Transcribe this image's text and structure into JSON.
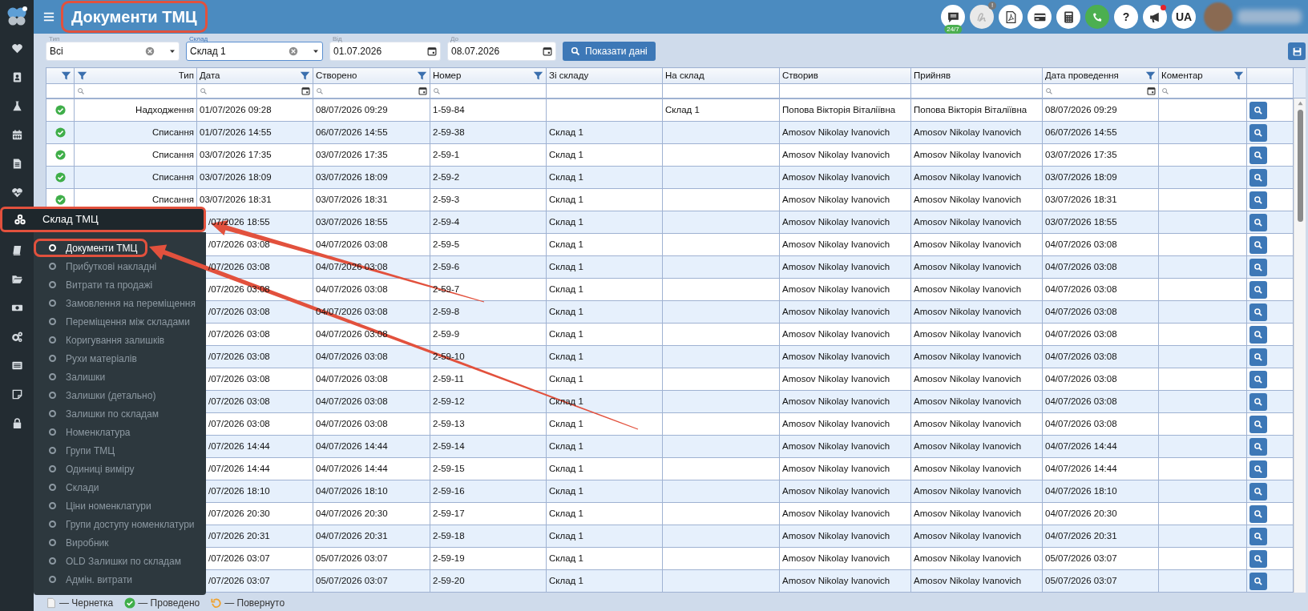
{
  "header": {
    "title": "Документи ТМЦ",
    "highlighted": true,
    "tools": [
      {
        "kind": "chat",
        "badge": "24/7",
        "disabled": false,
        "notification": false
      },
      {
        "kind": "signature",
        "badge": "!",
        "disabled": true,
        "notification": false
      },
      {
        "kind": "pdf",
        "disabled": false,
        "notification": false
      },
      {
        "kind": "card",
        "disabled": false,
        "notification": false
      },
      {
        "kind": "calculator",
        "disabled": false,
        "notification": false
      },
      {
        "kind": "phone",
        "disabled": false,
        "notification": false
      },
      {
        "kind": "help",
        "label": "?",
        "disabled": false,
        "notification": false
      },
      {
        "kind": "announce",
        "disabled": false,
        "notification": true
      },
      {
        "kind": "language",
        "label": "UA",
        "disabled": false,
        "notification": false
      }
    ]
  },
  "sidebar": {
    "items": [
      {
        "kind": "heart",
        "expanded": false
      },
      {
        "kind": "contacts",
        "expanded": false
      },
      {
        "kind": "flask",
        "expanded": false
      },
      {
        "kind": "calendar",
        "expanded": false
      },
      {
        "kind": "document",
        "expanded": false
      },
      {
        "kind": "pulse",
        "expanded": false
      },
      {
        "kind": "boxes",
        "expanded": true,
        "label": "Склад ТМЦ",
        "highlighted": true,
        "children": [
          {
            "label": "Документи ТМЦ",
            "selected": true,
            "highlighted": true
          },
          {
            "label": "Прибуткові накладні",
            "selected": false,
            "highlighted": false
          },
          {
            "label": "Витрати та продажі",
            "selected": false,
            "highlighted": false
          },
          {
            "label": "Замовлення на переміщення",
            "selected": false,
            "highlighted": false
          },
          {
            "label": "Переміщення між складами",
            "selected": false,
            "highlighted": false
          },
          {
            "label": "Коригування залишків",
            "selected": false,
            "highlighted": false
          },
          {
            "label": "Рухи матеріалів",
            "selected": false,
            "highlighted": false
          },
          {
            "label": "Залишки",
            "selected": false,
            "highlighted": false
          },
          {
            "label": "Залишки (детально)",
            "selected": false,
            "highlighted": false
          },
          {
            "label": "Залишки по складам",
            "selected": false,
            "highlighted": false
          },
          {
            "label": "Номенклатура",
            "selected": false,
            "highlighted": false
          },
          {
            "label": "Групи ТМЦ",
            "selected": false,
            "highlighted": false
          },
          {
            "label": "Одиниці виміру",
            "selected": false,
            "highlighted": false
          },
          {
            "label": "Склади",
            "selected": false,
            "highlighted": false
          },
          {
            "label": "Ціни номенклатури",
            "selected": false,
            "highlighted": false
          },
          {
            "label": "Групи доступу номенклатури",
            "selected": false,
            "highlighted": false
          },
          {
            "label": "Виробник",
            "selected": false,
            "highlighted": false
          },
          {
            "label": "OLD Залишки по складам",
            "selected": false,
            "highlighted": false
          },
          {
            "label": "Адмін. витрати",
            "selected": false,
            "highlighted": false
          }
        ]
      },
      {
        "kind": "book",
        "expanded": false
      },
      {
        "kind": "folder",
        "expanded": false
      },
      {
        "kind": "money",
        "expanded": false
      },
      {
        "kind": "gears",
        "expanded": false
      },
      {
        "kind": "list",
        "expanded": false
      },
      {
        "kind": "note",
        "expanded": false
      },
      {
        "kind": "lock",
        "expanded": false
      }
    ]
  },
  "filters": [
    {
      "kind": "select",
      "label": "Тип",
      "value": "Всі",
      "focused": false
    },
    {
      "kind": "select",
      "label": "Склад",
      "value": "Склад 1",
      "focused": true
    },
    {
      "kind": "date",
      "label": "Від",
      "value": "01.07.2026",
      "focused": false
    },
    {
      "kind": "date",
      "label": "До",
      "value": "08.07.2026",
      "focused": false
    }
  ],
  "show_button": "Показати дані",
  "table": {
    "columns": [
      {
        "filter": true,
        "searchable": false,
        "date_search": false
      },
      {
        "label": "Тип",
        "filter": true,
        "searchable": true,
        "date_search": false,
        "right_aligned": true
      },
      {
        "label": "Дата",
        "filter": true,
        "searchable": true,
        "date_search": true,
        "right_aligned": false
      },
      {
        "label": "Створено",
        "filter": true,
        "searchable": true,
        "date_search": true,
        "right_aligned": false
      },
      {
        "label": "Номер",
        "filter": true,
        "searchable": true,
        "date_search": false,
        "right_aligned": false
      },
      {
        "label": "Зі складу",
        "filter": false,
        "searchable": false,
        "date_search": false,
        "right_aligned": false
      },
      {
        "label": "На склад",
        "filter": false,
        "searchable": false,
        "date_search": false,
        "right_aligned": false
      },
      {
        "label": "Створив",
        "filter": false,
        "searchable": false,
        "date_search": false,
        "right_aligned": false
      },
      {
        "label": "Прийняв",
        "filter": false,
        "searchable": false,
        "date_search": false,
        "right_aligned": false
      },
      {
        "label": "Дата проведення",
        "filter": true,
        "searchable": true,
        "date_search": true,
        "right_aligned": false
      },
      {
        "label": "Коментар",
        "filter": true,
        "searchable": true,
        "date_search": false,
        "right_aligned": false
      },
      {
        "filter": false,
        "searchable": false,
        "date_search": false
      }
    ],
    "rows": [
      {
        "posted": true,
        "type": "Надходження",
        "date": "01/07/2026 09:28",
        "created": "08/07/2026 09:29",
        "number": "1-59-84",
        "to": "Склад 1",
        "creator": "Попова Вікторія Віталіївна",
        "acceptor": "Попова Вікторія Віталіївна",
        "posted_at": "08/07/2026 09:29"
      },
      {
        "posted": true,
        "type": "Списання",
        "date": "01/07/2026 14:55",
        "created": "06/07/2026 14:55",
        "number": "2-59-38",
        "from": "Склад 1",
        "creator": "Amosov Nikolay Ivanovich",
        "acceptor": "Amosov Nikolay Ivanovich",
        "posted_at": "06/07/2026 14:55"
      },
      {
        "posted": true,
        "type": "Списання",
        "date": "03/07/2026 17:35",
        "created": "03/07/2026 17:35",
        "number": "2-59-1",
        "from": "Склад 1",
        "creator": "Amosov Nikolay Ivanovich",
        "acceptor": "Amosov Nikolay Ivanovich",
        "posted_at": "03/07/2026 17:35"
      },
      {
        "posted": true,
        "type": "Списання",
        "date": "03/07/2026 18:09",
        "created": "03/07/2026 18:09",
        "number": "2-59-2",
        "from": "Склад 1",
        "creator": "Amosov Nikolay Ivanovich",
        "acceptor": "Amosov Nikolay Ivanovich",
        "posted_at": "03/07/2026 18:09"
      },
      {
        "posted": true,
        "type": "Списання",
        "date": "03/07/2026 18:31",
        "created": "03/07/2026 18:31",
        "number": "2-59-3",
        "from": "Склад 1",
        "creator": "Amosov Nikolay Ivanovich",
        "acceptor": "Amosov Nikolay Ivanovich",
        "posted_at": "03/07/2026 18:31"
      },
      {
        "date": "/07/2026 18:55",
        "created": "03/07/2026 18:55",
        "number": "2-59-4",
        "from": "Склад 1",
        "creator": "Amosov Nikolay Ivanovich",
        "acceptor": "Amosov Nikolay Ivanovich",
        "posted_at": "03/07/2026 18:55"
      },
      {
        "date": "/07/2026 03:08",
        "created": "04/07/2026 03:08",
        "number": "2-59-5",
        "from": "Склад 1",
        "creator": "Amosov Nikolay Ivanovich",
        "acceptor": "Amosov Nikolay Ivanovich",
        "posted_at": "04/07/2026 03:08"
      },
      {
        "date": "/07/2026 03:08",
        "created": "04/07/2026 03:08",
        "number": "2-59-6",
        "from": "Склад 1",
        "creator": "Amosov Nikolay Ivanovich",
        "acceptor": "Amosov Nikolay Ivanovich",
        "posted_at": "04/07/2026 03:08"
      },
      {
        "date": "/07/2026 03:08",
        "created": "04/07/2026 03:08",
        "number": "2-59-7",
        "from": "Склад 1",
        "creator": "Amosov Nikolay Ivanovich",
        "acceptor": "Amosov Nikolay Ivanovich",
        "posted_at": "04/07/2026 03:08"
      },
      {
        "date": "/07/2026 03:08",
        "created": "04/07/2026 03:08",
        "number": "2-59-8",
        "from": "Склад 1",
        "creator": "Amosov Nikolay Ivanovich",
        "acceptor": "Amosov Nikolay Ivanovich",
        "posted_at": "04/07/2026 03:08"
      },
      {
        "date": "/07/2026 03:08",
        "created": "04/07/2026 03:08",
        "number": "2-59-9",
        "from": "Склад 1",
        "creator": "Amosov Nikolay Ivanovich",
        "acceptor": "Amosov Nikolay Ivanovich",
        "posted_at": "04/07/2026 03:08"
      },
      {
        "date": "/07/2026 03:08",
        "created": "04/07/2026 03:08",
        "number": "2-59-10",
        "from": "Склад 1",
        "creator": "Amosov Nikolay Ivanovich",
        "acceptor": "Amosov Nikolay Ivanovich",
        "posted_at": "04/07/2026 03:08"
      },
      {
        "date": "/07/2026 03:08",
        "created": "04/07/2026 03:08",
        "number": "2-59-11",
        "from": "Склад 1",
        "creator": "Amosov Nikolay Ivanovich",
        "acceptor": "Amosov Nikolay Ivanovich",
        "posted_at": "04/07/2026 03:08"
      },
      {
        "date": "/07/2026 03:08",
        "created": "04/07/2026 03:08",
        "number": "2-59-12",
        "from": "Склад 1",
        "creator": "Amosov Nikolay Ivanovich",
        "acceptor": "Amosov Nikolay Ivanovich",
        "posted_at": "04/07/2026 03:08"
      },
      {
        "date": "/07/2026 03:08",
        "created": "04/07/2026 03:08",
        "number": "2-59-13",
        "from": "Склад 1",
        "creator": "Amosov Nikolay Ivanovich",
        "acceptor": "Amosov Nikolay Ivanovich",
        "posted_at": "04/07/2026 03:08"
      },
      {
        "date": "/07/2026 14:44",
        "created": "04/07/2026 14:44",
        "number": "2-59-14",
        "from": "Склад 1",
        "creator": "Amosov Nikolay Ivanovich",
        "acceptor": "Amosov Nikolay Ivanovich",
        "posted_at": "04/07/2026 14:44"
      },
      {
        "date": "/07/2026 14:44",
        "created": "04/07/2026 14:44",
        "number": "2-59-15",
        "from": "Склад 1",
        "creator": "Amosov Nikolay Ivanovich",
        "acceptor": "Amosov Nikolay Ivanovich",
        "posted_at": "04/07/2026 14:44"
      },
      {
        "date": "/07/2026 18:10",
        "created": "04/07/2026 18:10",
        "number": "2-59-16",
        "from": "Склад 1",
        "creator": "Amosov Nikolay Ivanovich",
        "acceptor": "Amosov Nikolay Ivanovich",
        "posted_at": "04/07/2026 18:10"
      },
      {
        "date": "/07/2026 20:30",
        "created": "04/07/2026 20:30",
        "number": "2-59-17",
        "from": "Склад 1",
        "creator": "Amosov Nikolay Ivanovich",
        "acceptor": "Amosov Nikolay Ivanovich",
        "posted_at": "04/07/2026 20:30"
      },
      {
        "date": "/07/2026 20:31",
        "created": "04/07/2026 20:31",
        "number": "2-59-18",
        "from": "Склад 1",
        "creator": "Amosov Nikolay Ivanovich",
        "acceptor": "Amosov Nikolay Ivanovich",
        "posted_at": "04/07/2026 20:31"
      },
      {
        "date": "/07/2026 03:07",
        "created": "05/07/2026 03:07",
        "number": "2-59-19",
        "from": "Склад 1",
        "creator": "Amosov Nikolay Ivanovich",
        "acceptor": "Amosov Nikolay Ivanovich",
        "posted_at": "05/07/2026 03:07"
      },
      {
        "date": "/07/2026 03:07",
        "created": "05/07/2026 03:07",
        "number": "2-59-20",
        "from": "Склад 1",
        "creator": "Amosov Nikolay Ivanovich",
        "acceptor": "Amosov Nikolay Ivanovich",
        "posted_at": "05/07/2026 03:07"
      }
    ]
  },
  "legend": [
    {
      "kind": "draft",
      "label": "— Чернетка"
    },
    {
      "kind": "posted",
      "label": "— Проведено"
    },
    {
      "kind": "returned",
      "label": "— Повернуто"
    }
  ]
}
